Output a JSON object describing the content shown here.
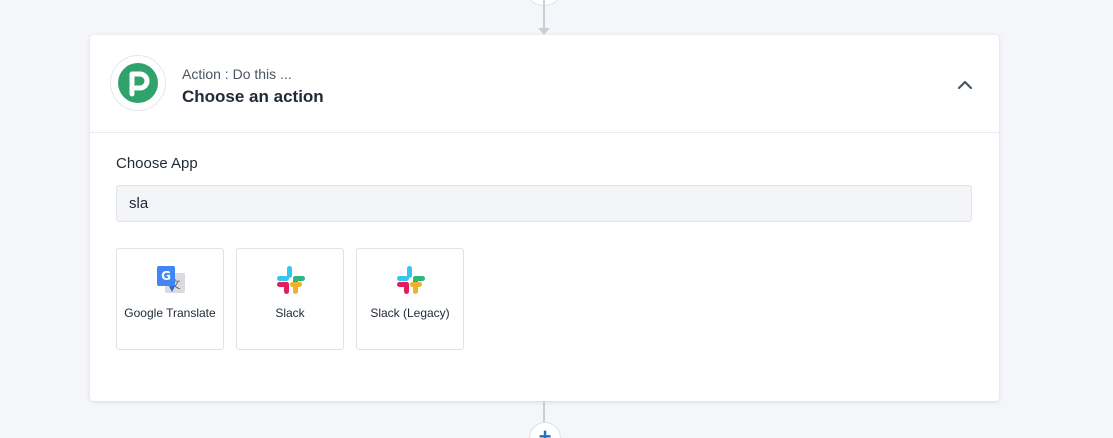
{
  "step": {
    "subtitle": "Action : Do this ...",
    "title": "Choose an action",
    "logo_icon": "pipedream-p-logo",
    "collapse_icon": "chevron-up-icon"
  },
  "choose_app": {
    "label": "Choose App",
    "search_value": "sla"
  },
  "apps": [
    {
      "label": "Google Translate",
      "icon": "google-translate-icon"
    },
    {
      "label": "Slack",
      "icon": "slack-icon"
    },
    {
      "label": "Slack (Legacy)",
      "icon": "slack-icon"
    }
  ],
  "add_step": {
    "label": "+"
  },
  "colors": {
    "brand_green": "#2fa36b",
    "accent_blue": "#1a73c9",
    "background": "#f4f6f9"
  }
}
